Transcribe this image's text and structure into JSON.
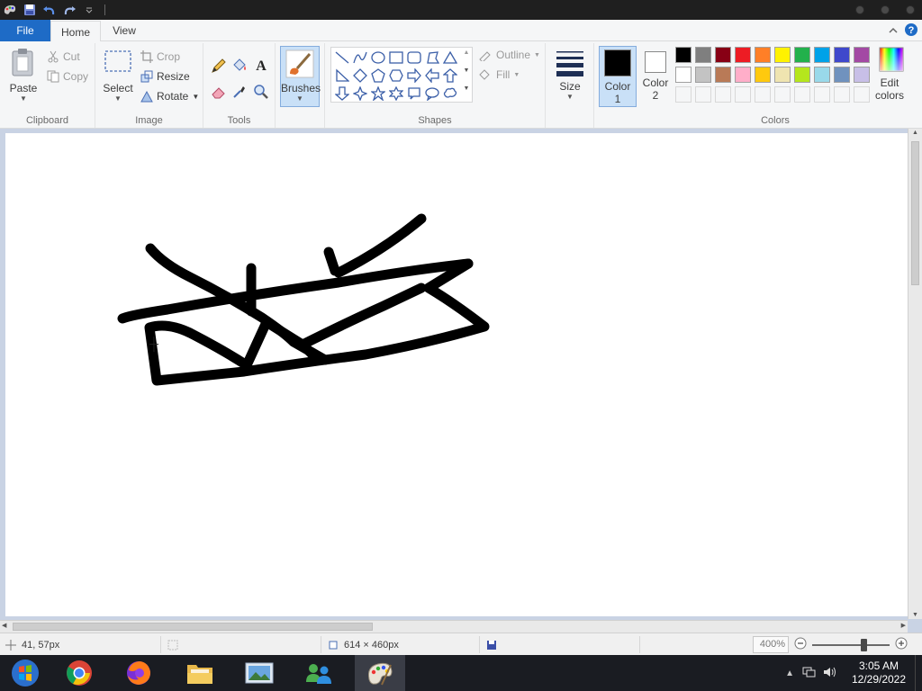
{
  "qat": {
    "app_icon": "paint-app-icon",
    "save_icon": "save-icon",
    "undo_icon": "undo-icon",
    "redo_icon": "redo-icon",
    "customize_icon": "chevron-down-icon"
  },
  "tabs": {
    "file": "File",
    "home": "Home",
    "view": "View"
  },
  "ribbon": {
    "clipboard": {
      "label": "Clipboard",
      "paste": "Paste",
      "cut": "Cut",
      "copy": "Copy"
    },
    "image": {
      "label": "Image",
      "select": "Select",
      "crop": "Crop",
      "resize": "Resize",
      "rotate": "Rotate"
    },
    "tools": {
      "label": "Tools"
    },
    "brushes": "Brushes",
    "shapes": {
      "label": "Shapes",
      "outline": "Outline",
      "fill": "Fill"
    },
    "size": "Size",
    "color1": "Color 1",
    "color2": "Color 2",
    "colors": {
      "label": "Colors",
      "edit": "Edit colors",
      "row1": [
        "#000000",
        "#7f7f7f",
        "#880015",
        "#ed1c24",
        "#ff7f27",
        "#fff200",
        "#22b14c",
        "#00a2e8",
        "#3f48cc",
        "#a349a4"
      ],
      "row2": [
        "#ffffff",
        "#c3c3c3",
        "#b97a57",
        "#ffaec9",
        "#ffc90e",
        "#efe4b0",
        "#b5e61d",
        "#99d9ea",
        "#7092be",
        "#c8bfe7"
      ]
    }
  },
  "status": {
    "cursor_pos": "41, 57px",
    "dimensions": "614 × 460px",
    "zoom": "400%"
  },
  "taskbar": {
    "time": "3:05 AM",
    "date": "12/29/2022"
  }
}
